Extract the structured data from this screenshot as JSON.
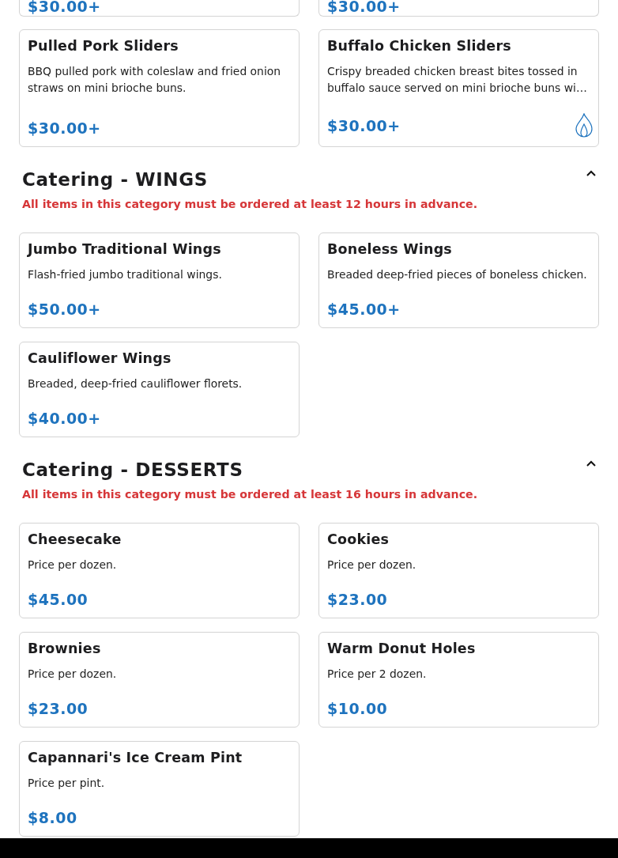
{
  "partial_items": [
    {
      "price": "$30.00+"
    },
    {
      "price": "$30.00+"
    }
  ],
  "top_items": [
    {
      "name": "Pulled Pork Sliders",
      "description": "BBQ pulled pork with coleslaw and fried onion straws on mini brioche buns.",
      "price": "$30.00+",
      "spicy": false
    },
    {
      "name": "Buffalo Chicken Sliders",
      "description": "Crispy breaded chicken breast bites tossed in buffalo sauce served on mini brioche buns wi…",
      "price": "$30.00+",
      "spicy": true
    }
  ],
  "sections": [
    {
      "title": "Catering - WINGS",
      "expanded": true,
      "notice": "All items in this category must be ordered at least 12 hours in advance.",
      "items": [
        {
          "name": "Jumbo Traditional Wings",
          "description": "Flash-fried jumbo traditional wings.",
          "price": "$50.00+",
          "spicy": false
        },
        {
          "name": "Boneless Wings",
          "description": "Breaded deep-fried pieces of boneless chicken.",
          "price": "$45.00+",
          "spicy": false
        },
        {
          "name": "Cauliflower Wings",
          "description": "Breaded, deep-fried cauliflower florets.",
          "price": "$40.00+",
          "spicy": false
        }
      ]
    },
    {
      "title": "Catering - DESSERTS",
      "expanded": true,
      "notice": "All items in this category must be ordered at least 16 hours in advance.",
      "items": [
        {
          "name": "Cheesecake",
          "description": "Price per dozen.",
          "price": "$45.00",
          "spicy": false
        },
        {
          "name": "Cookies",
          "description": "Price per dozen.",
          "price": "$23.00",
          "spicy": false
        },
        {
          "name": "Brownies",
          "description": "Price per dozen.",
          "price": "$23.00",
          "spicy": false
        },
        {
          "name": "Warm Donut Holes",
          "description": "Price per 2 dozen.",
          "price": "$10.00",
          "spicy": false
        },
        {
          "name": "Capannari's Ice Cream Pint",
          "description": "Price per pint.",
          "price": "$8.00",
          "spicy": false
        }
      ]
    }
  ]
}
